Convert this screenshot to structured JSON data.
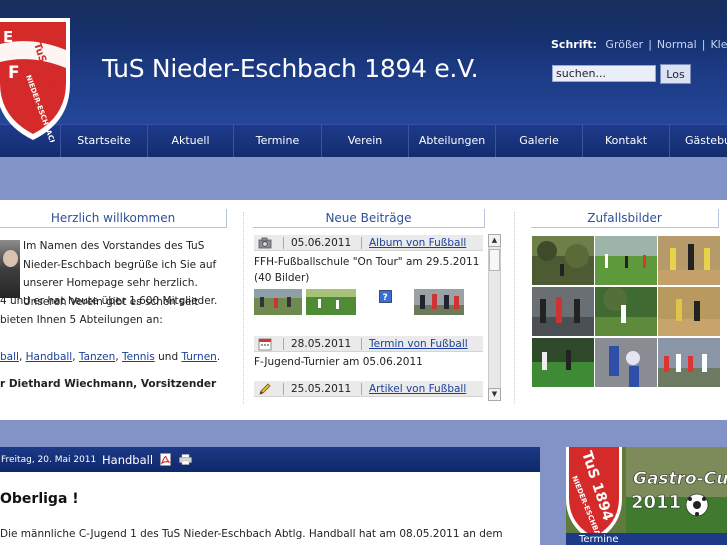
{
  "header": {
    "site_title": "TuS Nieder-Eschbach 1894 e.V.",
    "logo_text": "TuS 1894 NIEDER-ESCHBACH",
    "font_control": {
      "label": "Schrift:",
      "options": [
        "Größer",
        "Normal",
        "Klein"
      ]
    },
    "search": {
      "placeholder": "suchen...",
      "button": "Los"
    }
  },
  "nav": {
    "items": [
      "Startseite",
      "Aktuell",
      "Termine",
      "Verein",
      "Abteilungen",
      "Galerie",
      "Kontakt",
      "Gästebuch"
    ]
  },
  "welcome": {
    "title": "Herzlich willkommen",
    "lines": [
      "Im Namen des Vorstandes des TuS",
      "Nieder-Eschbach begrüße ich Sie auf",
      "unserer Homepage sehr herzlich.",
      "Unseren Verein gibt es schon seit",
      "4 und er hat heute über 1.600 Mitglieder.",
      "bieten Ihnen 5 Abteilungen an:"
    ],
    "sports": [
      "ball",
      "Handball",
      "Tanzen",
      "Tennis",
      "Turnen"
    ],
    "sports_sep": ", ",
    "sports_and": " und ",
    "sports_end": ".",
    "signature": "r Diethard Wiechmann, Vorsitzender"
  },
  "news": {
    "title": "Neue Beiträge",
    "entries": [
      {
        "icon": "camera-icon",
        "date": "05.06.2011",
        "link": "Album von Fußball"
      },
      {
        "icon": "calendar-icon",
        "date": "28.05.2011",
        "link": "Termin von Fußball"
      },
      {
        "icon": "pencil-icon",
        "date": "25.05.2011",
        "link": "Artikel von Fußball"
      }
    ],
    "entry1_text": [
      "FFH-Fußballschule \"On Tour\" am 29.5.2011",
      "(40 Bilder)"
    ],
    "entry2_text": "F-Jugend-Turnier am 05.06.2011"
  },
  "random_images": {
    "title": "Zufallsbilder"
  },
  "article": {
    "date": "Freitag, 20. Mai 2011",
    "category": "Handball",
    "title": "Oberliga !",
    "text": "Die männliche C-Jugend 1 des TuS Nieder-Eschbach Abtlg. Handball hat am 08.05.2011 an dem"
  },
  "promo": {
    "logo_text": "TuS 1894 NIEDER-ESCHBACH",
    "headline": "Gastro-Cup",
    "year": "2011",
    "footer": "Termine"
  },
  "colors": {
    "header_dark": "#0e2556",
    "nav": "#1a3580",
    "band": "#8293c7",
    "link": "#1b3f9e",
    "title": "#2e4f9c",
    "logo_red": "#d42a2a"
  }
}
